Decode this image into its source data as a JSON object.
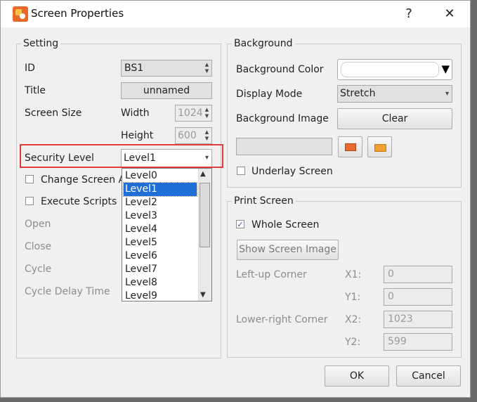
{
  "window": {
    "title": "Screen Properties",
    "help_label": "?",
    "close_label": "✕"
  },
  "setting": {
    "group_title": "Setting",
    "id_label": "ID",
    "id_value": "BS1",
    "title_label": "Title",
    "title_value": "unnamed",
    "screen_size_label": "Screen Size",
    "width_label": "Width",
    "width_value": "1024",
    "height_label": "Height",
    "height_value": "600",
    "security_label": "Security Level",
    "security_value": "Level1",
    "change_screen_label": "Change Screen A",
    "execute_scripts_label": "Execute Scripts",
    "open_label": "Open",
    "close_label": "Close",
    "cycle_label": "Cycle",
    "cycle_delay_label": "Cycle Delay Time"
  },
  "security_dropdown": {
    "options": [
      "Level0",
      "Level1",
      "Level2",
      "Level3",
      "Level4",
      "Level5",
      "Level6",
      "Level7",
      "Level8",
      "Level9"
    ],
    "selected_index": 1
  },
  "background": {
    "group_title": "Background",
    "color_label": "Background Color",
    "display_mode_label": "Display Mode",
    "display_mode_value": "Stretch",
    "image_label": "Background Image",
    "clear_label": "Clear",
    "underlay_label": "Underlay Screen"
  },
  "print_screen": {
    "group_title": "Print Screen",
    "whole_screen_label": "Whole Screen",
    "show_image_label": "Show Screen Image",
    "left_up_label": "Left-up Corner",
    "lower_right_label": "Lower-right Corner",
    "x1_label": "X1:",
    "x1_value": "0",
    "y1_label": "Y1:",
    "y1_value": "0",
    "x2_label": "X2:",
    "x2_value": "1023",
    "y2_label": "Y2:",
    "y2_value": "599"
  },
  "footer": {
    "ok_label": "OK",
    "cancel_label": "Cancel"
  },
  "icons": {
    "dropdown_arrow": "▾",
    "dropdown_arrow_black": "▼",
    "spin_up": "▲",
    "spin_down": "▼",
    "check": "✓",
    "scroll_up": "▲",
    "scroll_down": "▼"
  },
  "colors": {
    "selection": "#1f6fd6",
    "highlight_box": "#e23b3b"
  }
}
